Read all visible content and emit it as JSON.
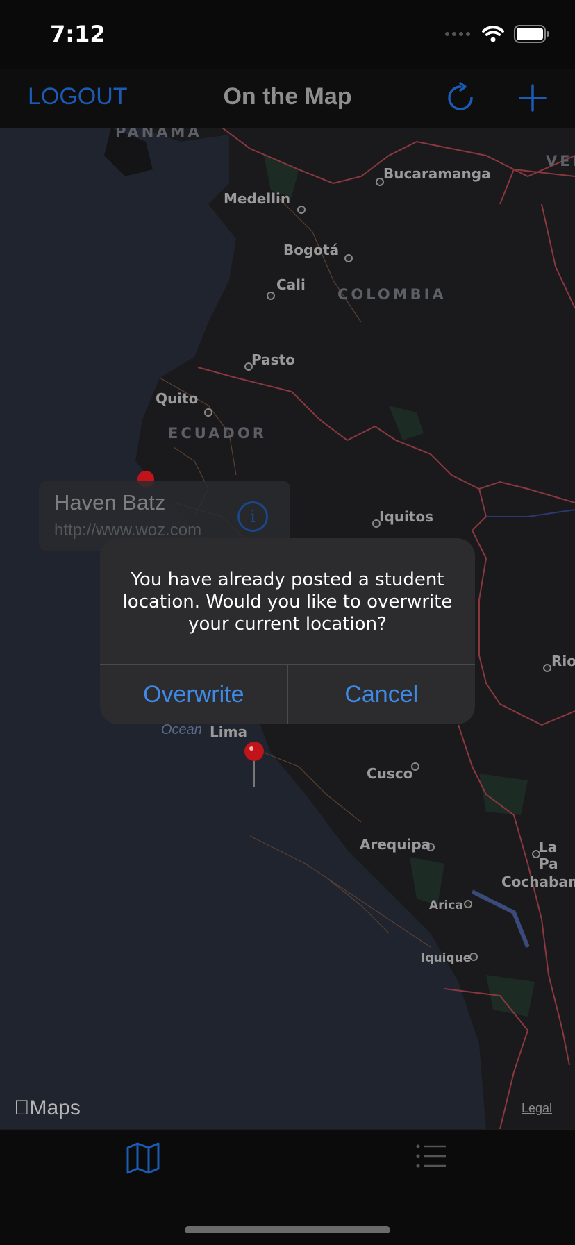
{
  "status_bar": {
    "time": "7:12"
  },
  "nav": {
    "left_label": "LOGOUT",
    "title": "On the Map"
  },
  "map": {
    "countries": [
      "PANAMA",
      "COLOMBIA",
      "ECUADOR",
      "VEN"
    ],
    "cities": [
      "Bucaramanga",
      "Medellin",
      "Bogotá",
      "Cali",
      "Pasto",
      "Quito",
      "Iquitos",
      "Lima",
      "Cusco",
      "Arequipa",
      "La Pa",
      "Cochabam",
      "Arica",
      "Iquique",
      "Rio"
    ],
    "ocean": "Pacific\nOcean",
    "maps_label": "Maps",
    "legal_label": "Legal"
  },
  "callout": {
    "title": "Haven Batz",
    "subtitle": "http://www.woz.com"
  },
  "alert": {
    "message": "You have already posted a student location. Would you like to overwrite your current location?",
    "primary": "Overwrite",
    "secondary": "Cancel"
  },
  "colors": {
    "accent": "#1b5bb3",
    "alert_button": "#3e8ae6",
    "pin": "#c0141a"
  }
}
